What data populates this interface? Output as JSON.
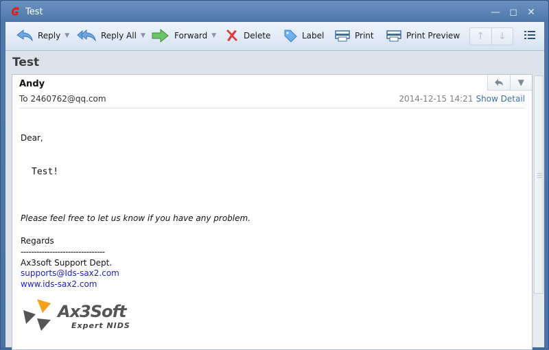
{
  "window": {
    "title": "Test",
    "app_icon": "foxmail-logo-icon",
    "controls": [
      "minimize",
      "maximize",
      "close"
    ]
  },
  "toolbar": {
    "buttons": [
      {
        "id": "reply",
        "label": "Reply",
        "icon": "reply-icon",
        "has_menu": true
      },
      {
        "id": "reply-all",
        "label": "Reply All",
        "icon": "reply-all-icon",
        "has_menu": true
      },
      {
        "id": "forward",
        "label": "Forward",
        "icon": "forward-icon",
        "has_menu": true
      },
      {
        "id": "delete",
        "label": "Delete",
        "icon": "delete-icon",
        "has_menu": false
      },
      {
        "id": "label",
        "label": "Label",
        "icon": "tag-icon",
        "has_menu": false
      },
      {
        "id": "print",
        "label": "Print",
        "icon": "printer-icon",
        "has_menu": false
      },
      {
        "id": "print-preview",
        "label": "Print Preview",
        "icon": "printer-icon",
        "has_menu": false
      }
    ],
    "nav": {
      "prev": "↑",
      "next": "↓"
    },
    "menu_icon": "list-menu-icon"
  },
  "message": {
    "subject": "Test",
    "sender": "Andy",
    "to": "To 2460762@qq.com",
    "datetime": "2014-12-15 14:21",
    "show_detail": "Show Detail",
    "body": {
      "greeting": "Dear,",
      "text": "Test!",
      "note": "Please feel free to let us know if you have any problem.",
      "regards": "Regards",
      "separator": "--------------------------------",
      "dept": "Ax3soft Support Dept.",
      "email": "supports@Ids-sax2.com",
      "website": "www.ids-sax2.com",
      "logo_name": "Ax3Soft",
      "logo_tagline": "Expert NIDS"
    }
  },
  "colors": {
    "titlebar": "#4f78aa",
    "link": "#1d1dcf",
    "accent_orange": "#f5a21b"
  }
}
